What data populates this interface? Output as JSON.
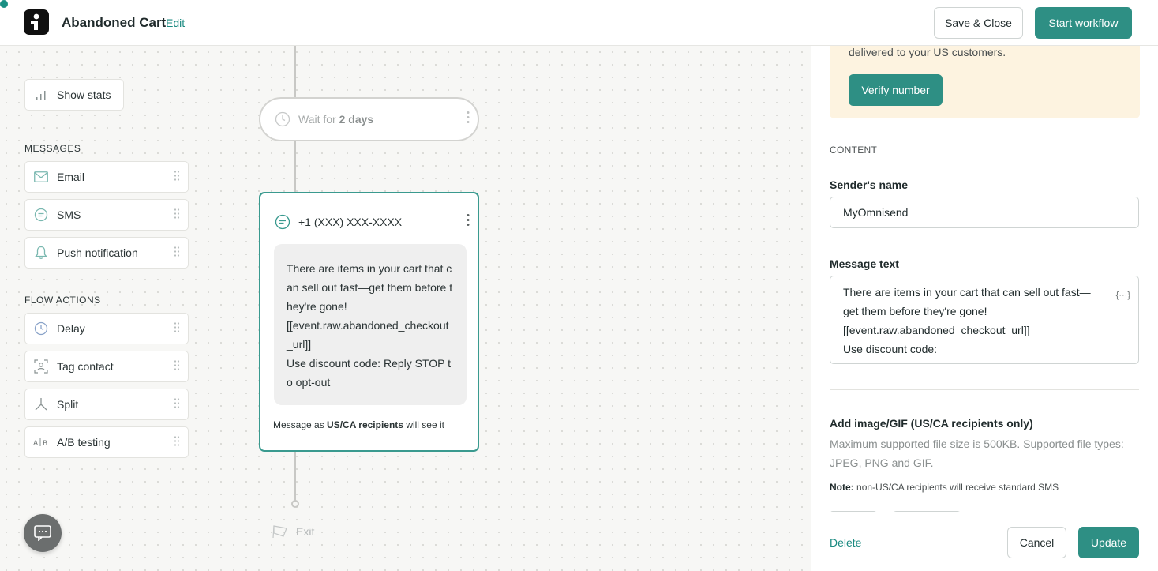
{
  "header": {
    "title": "Abandoned Cart",
    "edit_label": "Edit",
    "save_close_label": "Save & Close",
    "start_workflow_label": "Start workflow"
  },
  "sidebar": {
    "show_stats_label": "Show stats",
    "messages_label": "MESSAGES",
    "messages": [
      {
        "label": "Email",
        "icon": "mail-icon"
      },
      {
        "label": "SMS",
        "icon": "sms-icon"
      },
      {
        "label": "Push notification",
        "icon": "bell-icon"
      }
    ],
    "flow_actions_label": "FLOW ACTIONS",
    "flow_actions": [
      {
        "label": "Delay",
        "icon": "clock-icon"
      },
      {
        "label": "Tag contact",
        "icon": "tag-contact-icon"
      },
      {
        "label": "Split",
        "icon": "split-icon"
      },
      {
        "label": "A/B testing",
        "icon": "ab-icon"
      }
    ]
  },
  "flow": {
    "wait_prefix": "Wait for",
    "wait_value": "2 days",
    "sms_phone": "+1 (XXX) XXX-XXXX",
    "sms_message": "There are items in your cart that can sell out fast—get them before they're gone!\n[[event.raw.abandoned_checkout_url]]\nUse discount code: Reply STOP to opt-out",
    "sms_footer_prefix": "Message as",
    "sms_footer_bold": "US/CA recipients",
    "sms_footer_suffix": "will see it",
    "exit_label": "Exit"
  },
  "panel": {
    "warning_text": "delivered to your US customers.",
    "verify_label": "Verify number",
    "content_label": "CONTENT",
    "sender_label": "Sender's name",
    "sender_value": "MyOmnisend",
    "message_label": "Message text",
    "message_value": "There are items in your cart that can sell out fast—\nget them before they're gone!\n[[event.raw.abandoned_checkout_url]]\nUse discount code:",
    "var_icon_text": "{···}",
    "image_label": "Add image/GIF (US/CA recipients only)",
    "image_help": "Maximum supported file size is 500KB. Supported file types: JPEG, PNG and GIF.",
    "note_bold": "Note:",
    "note_text": "non-US/CA recipients will receive standard SMS",
    "delete_label": "Delete",
    "cancel_label": "Cancel",
    "update_label": "Update"
  },
  "colors": {
    "accent": "#2e8f84",
    "warning_bg": "#fdf3e0"
  }
}
